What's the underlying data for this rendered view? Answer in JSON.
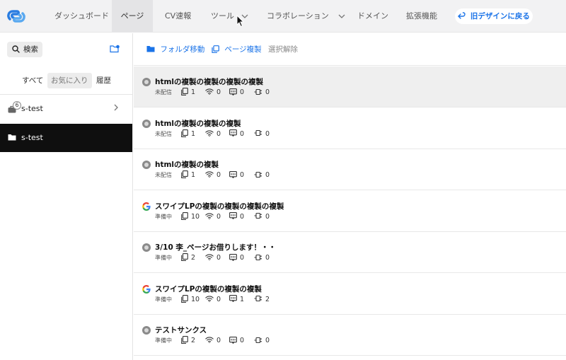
{
  "nav": {
    "items": [
      {
        "label": "ダッシュボード",
        "active": false,
        "has_dropdown": false
      },
      {
        "label": "ページ",
        "active": true,
        "has_dropdown": false
      },
      {
        "label": "CV速報",
        "active": false,
        "has_dropdown": false
      },
      {
        "label": "ツール",
        "active": false,
        "has_dropdown": true
      },
      {
        "label": "コラボレーション",
        "active": false,
        "has_dropdown": true
      },
      {
        "label": "ドメイン",
        "active": false,
        "has_dropdown": false
      },
      {
        "label": "拡張機能",
        "active": false,
        "has_dropdown": false
      }
    ],
    "old_design_label": "旧デザインに戻る",
    "accent_color": "#1a73e8"
  },
  "sidebar": {
    "search_label": "検索",
    "tabs": [
      "すべて",
      "お気に入り",
      "履歴"
    ],
    "folders": [
      {
        "name": "s-test",
        "badge": "6",
        "selected": false,
        "has_chevron": true,
        "icon": "briefcase-icon"
      },
      {
        "name": "s-test",
        "badge": "",
        "selected": true,
        "has_chevron": false,
        "icon": "folder-icon"
      }
    ]
  },
  "toolbar": {
    "move_folder_label": "フォルダ移動",
    "duplicate_label": "ページ複製",
    "deselect_label": "選択解除"
  },
  "pages": [
    {
      "title": "htmlの複製の複製の複製の複製",
      "status": "未配信",
      "icon": "status-dot",
      "highlight": true,
      "stats": {
        "variants": "1",
        "traffic": "0",
        "cv": "0",
        "integrations": "0"
      }
    },
    {
      "title": "htmlの複製の複製の複製",
      "status": "未配信",
      "icon": "status-dot",
      "highlight": false,
      "stats": {
        "variants": "1",
        "traffic": "0",
        "cv": "0",
        "integrations": "0"
      }
    },
    {
      "title": "htmlの複製の複製",
      "status": "未配信",
      "icon": "status-dot",
      "highlight": false,
      "stats": {
        "variants": "1",
        "traffic": "0",
        "cv": "0",
        "integrations": "0"
      }
    },
    {
      "title": "スワイプLPの複製の複製の複製の複製",
      "status": "準備中",
      "icon": "google-icon",
      "highlight": false,
      "stats": {
        "variants": "10",
        "traffic": "0",
        "cv": "0",
        "integrations": "0"
      }
    },
    {
      "title": "3/10 李_ページお借りします！・・",
      "status": "準備中",
      "icon": "status-dot",
      "highlight": false,
      "stats": {
        "variants": "2",
        "traffic": "0",
        "cv": "0",
        "integrations": "0"
      }
    },
    {
      "title": "スワイプLPの複製の複製の複製",
      "status": "準備中",
      "icon": "google-icon",
      "highlight": false,
      "stats": {
        "variants": "10",
        "traffic": "0",
        "cv": "1",
        "integrations": "2"
      }
    },
    {
      "title": "テストサンクス",
      "status": "準備中",
      "icon": "status-dot",
      "highlight": false,
      "stats": {
        "variants": "2",
        "traffic": "0",
        "cv": "0",
        "integrations": "0"
      }
    }
  ]
}
